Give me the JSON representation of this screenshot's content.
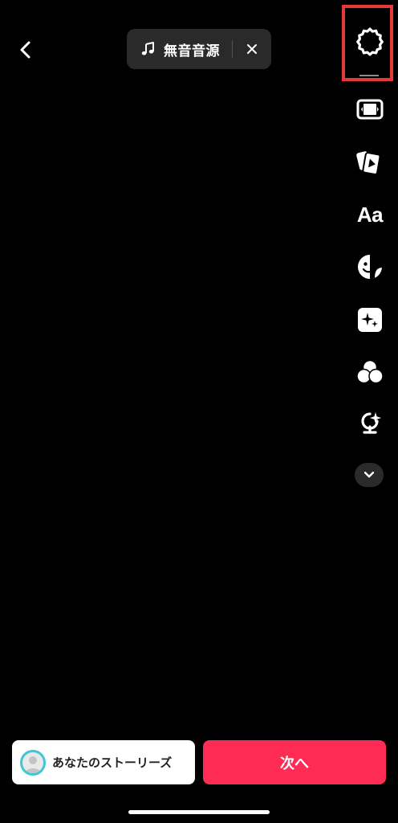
{
  "sound": {
    "title": "無音音源",
    "note_icon": "music-note-icon",
    "close_icon": "close-icon"
  },
  "nav": {
    "back_icon": "chevron-left-icon"
  },
  "toolbar": {
    "items": [
      {
        "name": "settings",
        "icon": "gear-icon"
      },
      {
        "name": "flip",
        "icon": "flip-icon"
      },
      {
        "name": "templates",
        "icon": "cards-icon"
      },
      {
        "name": "text",
        "icon": "text-icon",
        "label": "Aa"
      },
      {
        "name": "stickers",
        "icon": "sticker-icon"
      },
      {
        "name": "effects",
        "icon": "sparkle-icon"
      },
      {
        "name": "filters",
        "icon": "filters-icon"
      },
      {
        "name": "voice",
        "icon": "mic-sparkle-icon"
      },
      {
        "name": "more",
        "icon": "chevron-down-icon"
      }
    ],
    "highlight_color": "#e53935"
  },
  "bottom": {
    "story_label": "あなたのストーリーズ",
    "next_label": "次へ",
    "accent": "#fe2c55",
    "avatar_ring": "#3fc7d6"
  }
}
